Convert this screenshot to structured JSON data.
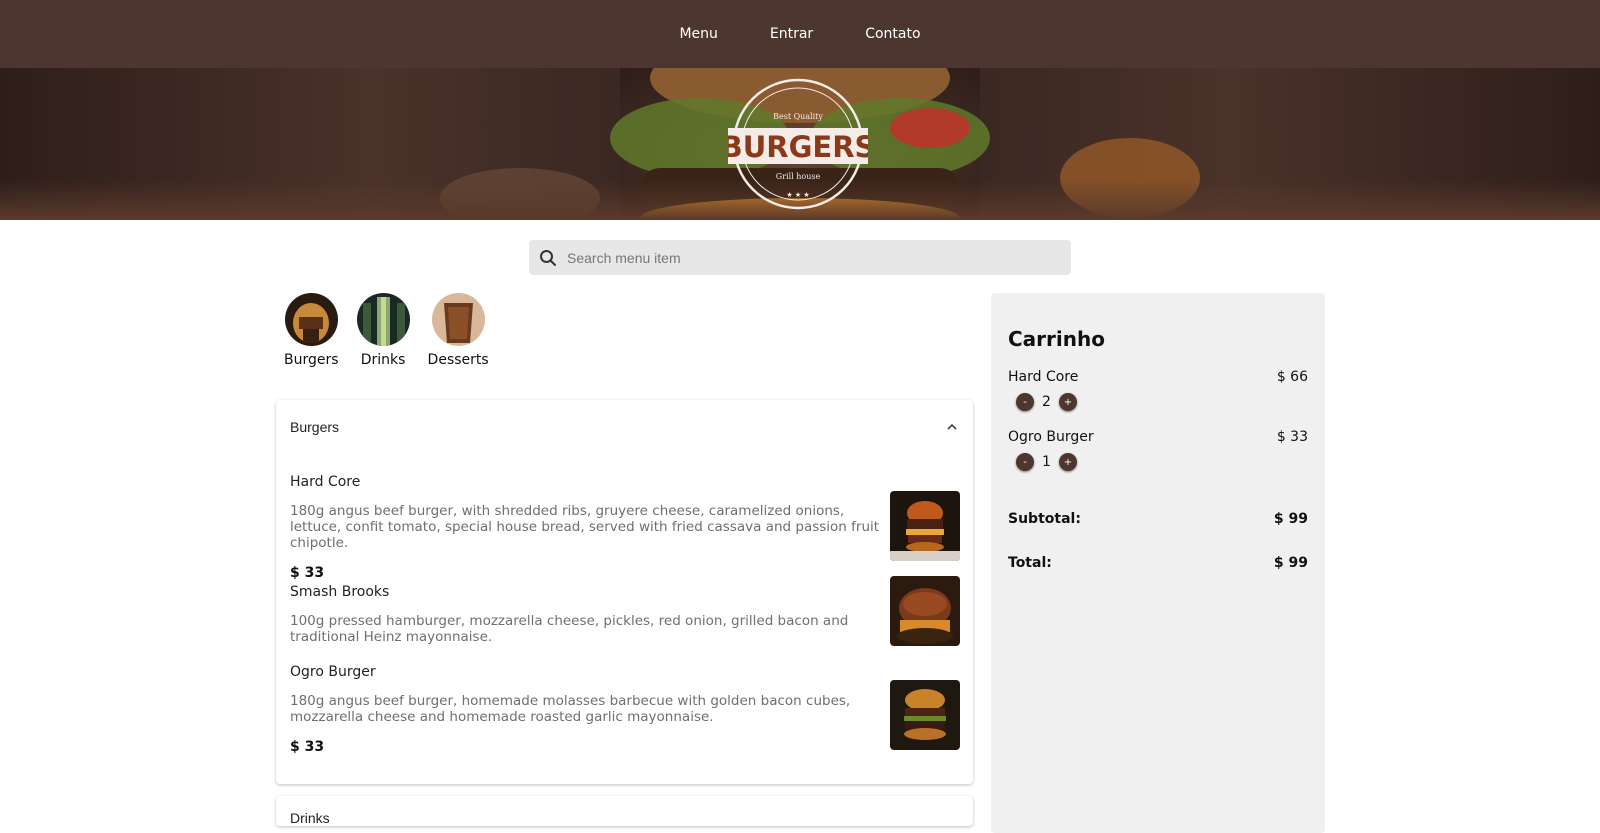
{
  "nav": {
    "items": [
      {
        "label": "Menu"
      },
      {
        "label": "Entrar"
      },
      {
        "label": "Contato"
      }
    ]
  },
  "hero": {
    "logo_text": "BURGERS",
    "logo_top_text": "Best Quality",
    "logo_bottom_text": "Grill house"
  },
  "search": {
    "placeholder": "Search menu item",
    "icon": "search-icon"
  },
  "categories": [
    {
      "label": "Burgers"
    },
    {
      "label": "Drinks"
    },
    {
      "label": "Desserts"
    }
  ],
  "menu": {
    "section_title": "Burgers",
    "items": [
      {
        "name": "Hard Core",
        "description": "180g angus beef burger, with shredded ribs, gruyere cheese, caramelized onions, lettuce, confit tomato, special house bread, served with fried cassava and passion fruit chipotle.",
        "price": "$ 33"
      },
      {
        "name": "Smash Brooks",
        "description": "100g pressed hamburger, mozzarella cheese, pickles, red onion, grilled bacon and traditional Heinz mayonnaise.",
        "price": ""
      },
      {
        "name": "Ogro Burger",
        "description": "180g angus beef burger, homemade molasses barbecue with golden bacon cubes, mozzarella cheese and homemade roasted garlic mayonnaise.",
        "price": "$ 33"
      }
    ],
    "next_section_title": "Drinks"
  },
  "cart": {
    "title": "Carrinho",
    "items": [
      {
        "name": "Hard Core",
        "price": "$ 66",
        "qty": "2",
        "minus": "-",
        "plus": "+"
      },
      {
        "name": "Ogro Burger",
        "price": "$ 33",
        "qty": "1",
        "minus": "-",
        "plus": "+"
      }
    ],
    "subtotal_label": "Subtotal:",
    "subtotal_value": "$ 99",
    "total_label": "Total:",
    "total_value": "$ 99"
  },
  "colors": {
    "navbar": "#4e3630",
    "cart_bg": "#f0f0f0",
    "search_bg": "#e7e7e7"
  }
}
